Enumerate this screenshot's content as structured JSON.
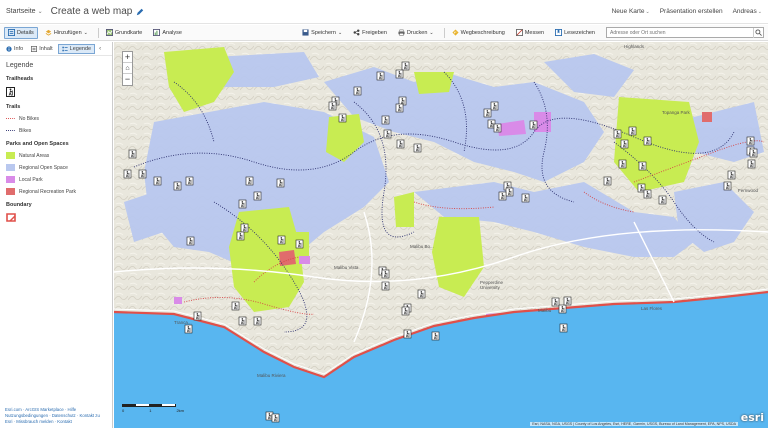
{
  "header": {
    "home_label": "Startseite",
    "map_title": "Create a web map",
    "new_map_label": "Neue Karte",
    "presentation_label": "Präsentation erstellen",
    "user_label": "Andreas"
  },
  "toolbar": {
    "details_label": "Details",
    "add_label": "Hinzufügen",
    "basemap_label": "Grundkarte",
    "analysis_label": "Analyse",
    "save_label": "Speichern",
    "share_label": "Freigeben",
    "print_label": "Drucken",
    "directions_label": "Wegbeschreibung",
    "measure_label": "Messen",
    "bookmarks_label": "Lesezeichen",
    "search_placeholder": "Adresse oder Ort suchen"
  },
  "panel": {
    "tabs": [
      {
        "label": "Info"
      },
      {
        "label": "Inhalt"
      },
      {
        "label": "Legende"
      }
    ],
    "heading": "Legende",
    "sections": {
      "trailheads": "Trailheads",
      "trails": "Trails",
      "trail_no_bikes": "No Bikes",
      "trail_bikes": "Bikes",
      "parks": "Parks and Open Spaces",
      "natural_areas": "Natural Areas",
      "regional_open_space": "Regional Open Space",
      "local_park": "Local Park",
      "regional_recreation_park": "Regional Recreation Park",
      "boundary": "Boundary"
    },
    "footer_lines": [
      "Esri.com · ArcGIS Marketplace · Hilfe",
      "Nutzungsbedingungen · Datenschutz · Kontakt zu",
      "Esri · Missbrauch melden · Kontakt"
    ]
  },
  "map": {
    "scale_labels": [
      "0",
      "1",
      "2km"
    ],
    "attribution": "Esri, NASA, NGA, USGS | County of Los Angeles, Esri, HERE, Garmin, USGS, Bureau of Land Management, EPA, NPS, USDA",
    "logo": "esri",
    "places": [
      "Highlands",
      "Topanga Park",
      "Fernwood",
      "Malibu Vista",
      "Malibu Bo...",
      "Pepperdine University",
      "Malibu",
      "Tranca...",
      "Malibu Riviera",
      "Las Flores"
    ]
  },
  "colors": {
    "natural_areas": "#c8ec52",
    "regional_open_space": "#b9c8ef",
    "local_park": "#d98be8",
    "regional_recreation_park": "#e06c6c",
    "boundary": "#e0504a",
    "ocean": "#58b6f0",
    "land": "#ebe9e0",
    "accent": "#2a6cb0"
  }
}
